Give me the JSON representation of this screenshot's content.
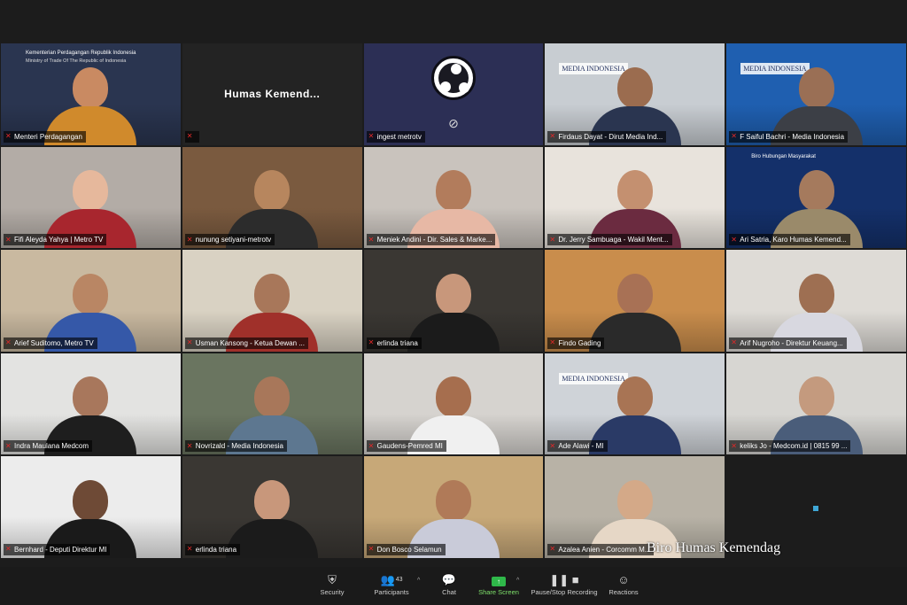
{
  "meeting": {
    "watermark": "Biro Humas Kemendag"
  },
  "tiles": [
    {
      "name": "Menteri Perdagangan",
      "bg": "#2a3550",
      "skin": "#c98a62",
      "shirt": "#d08a2c",
      "active": true,
      "banner_line1": "Kementerian Perdagangan Republik Indonesia",
      "banner_line2": "Ministry of Trade Of The Republic of Indonesia"
    },
    {
      "name": "",
      "display_name": "Humas Kemend...",
      "type": "nameonly"
    },
    {
      "name": "ingest metrotv",
      "type": "obs"
    },
    {
      "name": "Firdaus Dayat - Dirut Media Ind...",
      "bg": "#c8cdd2",
      "skin": "#9b6c4f",
      "shirt": "#2a3550",
      "logo": "MEDIA INDONESIA"
    },
    {
      "name": "F Saiful Bachri - Media Indonesia",
      "bg": "#1f5fb0",
      "skin": "#9a6f55",
      "shirt": "#3c3f46",
      "logo": "MEDIA INDONESIA"
    },
    {
      "name": "Fifi Aleyda Yahya | Metro TV",
      "bg": "#b3aca6",
      "skin": "#e6b89c",
      "shirt": "#a8262e"
    },
    {
      "name": "nunung setiyani-metrotv",
      "bg": "#7a5a3f",
      "skin": "#b7865e",
      "shirt": "#2c2c2c"
    },
    {
      "name": "Meniek Andini - Dir. Sales & Marke...",
      "bg": "#c9c3bd",
      "skin": "#b27c5c",
      "shirt": "#e7b8a5"
    },
    {
      "name": "Dr. Jerry Sambuaga - Wakil Ment...",
      "bg": "#e8e3dc",
      "skin": "#c49070",
      "shirt": "#6b2b40"
    },
    {
      "name": "Ari Satria, Karo Humas Kemend...",
      "bg": "#14306a",
      "skin": "#a57a5d",
      "shirt": "#9a8a6a",
      "banner_line1": "Biro Hubungan Masyarakat"
    },
    {
      "name": "Arief Suditomo, Metro TV",
      "bg": "#c9b9a0",
      "skin": "#b98664",
      "shirt": "#3558a8"
    },
    {
      "name": "Usman Kansong - Ketua Dewan ...",
      "bg": "#d9d2c3",
      "skin": "#a8775a",
      "shirt": "#a0302a"
    },
    {
      "name": "erlinda triana",
      "bg": "#3a3733",
      "skin": "#c8977b",
      "shirt": "#1b1b1b"
    },
    {
      "name": "Findo Gading",
      "bg": "#c98d4c",
      "skin": "#a87155",
      "shirt": "#2a2a2a"
    },
    {
      "name": "Arif Nugroho - Direktur Keuang...",
      "bg": "#dedbd6",
      "skin": "#9e6f52",
      "shirt": "#d8d8e0"
    },
    {
      "name": "Indra Maulana Medcom",
      "bg": "#e3e3e1",
      "skin": "#a8775c",
      "shirt": "#1e1e1e"
    },
    {
      "name": "Novrizald - Media Indonesia",
      "bg": "#6a7560",
      "skin": "#a8775a",
      "shirt": "#5d7790"
    },
    {
      "name": "Gaudens-Pemred MI",
      "bg": "#d6d3cf",
      "skin": "#a66e4e",
      "shirt": "#f0f0f0"
    },
    {
      "name": "Ade Alawi - MI",
      "bg": "#cfd3d8",
      "skin": "#a87454",
      "shirt": "#2a3a66",
      "logo": "MEDIA INDONESIA"
    },
    {
      "name": "keliks Jo - Medcom.id | 0815 99 ...",
      "bg": "#d7d6d2",
      "skin": "#c49a7e",
      "shirt": "#4a5d7a"
    },
    {
      "name": "Bernhard - Deputi Direktur MI",
      "bg": "#ececec",
      "skin": "#6e4a36",
      "shirt": "#1a1a1a"
    },
    {
      "name": "erlinda triana",
      "bg": "#3a3733",
      "skin": "#c8977b",
      "shirt": "#1b1b1b"
    },
    {
      "name": "Don Bosco Selamun",
      "bg": "#c7a878",
      "skin": "#b07a58",
      "shirt": "#c9cbd9"
    },
    {
      "name": "Azalea Anien - Corcomm M...",
      "bg": "#b8b2a6",
      "skin": "#d4a988",
      "shirt": "#e6d7c6"
    },
    {
      "name": "",
      "type": "empty"
    }
  ],
  "toolbar": {
    "items": [
      {
        "id": "security",
        "label": "Security",
        "icon": "shield-icon",
        "glyph": "⛨"
      },
      {
        "id": "participants",
        "label": "Participants",
        "icon": "participants-icon",
        "glyph": "👥",
        "count": "43"
      },
      {
        "id": "chat",
        "label": "Chat",
        "icon": "chat-icon",
        "glyph": "💬"
      },
      {
        "id": "share",
        "label": "Share Screen",
        "icon": "share-screen-icon",
        "glyph": "↑"
      },
      {
        "id": "record",
        "label": "Pause/Stop Recording",
        "icon": "pause-stop-icon",
        "glyph": "❚❚ ■"
      },
      {
        "id": "reactions",
        "label": "Reactions",
        "icon": "reactions-icon",
        "glyph": "☺"
      }
    ]
  }
}
